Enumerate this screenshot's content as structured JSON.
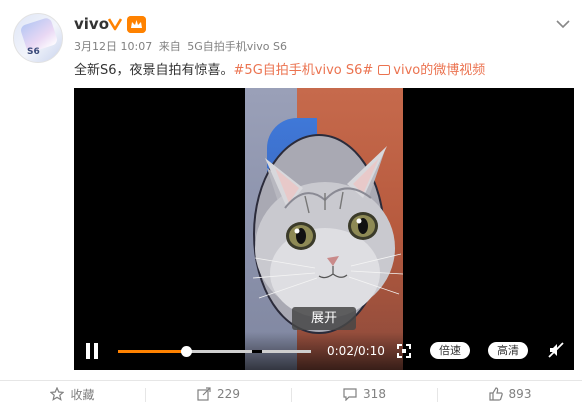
{
  "post": {
    "username": "vivo",
    "date": "3月12日 10:07",
    "source_prefix": "来自",
    "source": "5G自拍手机vivo S6",
    "text_main": "全新S6，夜景自拍有惊喜。",
    "hashtag": "#5G自拍手机vivo S6#",
    "link_label": "vivo的微博视频"
  },
  "avatar": {
    "label": "S6"
  },
  "video": {
    "expand_label": "展开",
    "time": "0:02/0:10",
    "progress": 0.35,
    "buffered": 1.0,
    "speed_label": "倍速",
    "quality_label": "高清"
  },
  "actions": {
    "favorite": "收藏",
    "repost": "229",
    "comment": "318",
    "like": "893"
  },
  "colors": {
    "accent": "#eb7350",
    "progress": "#ff8200",
    "muted_text": "#808080"
  },
  "icons": [
    "verified-icon",
    "member-badge-icon",
    "more-chevron-icon",
    "video-link-icon",
    "pause-icon",
    "fullscreen-icon",
    "mute-icon",
    "star-icon",
    "repost-icon",
    "comment-icon",
    "like-icon"
  ]
}
